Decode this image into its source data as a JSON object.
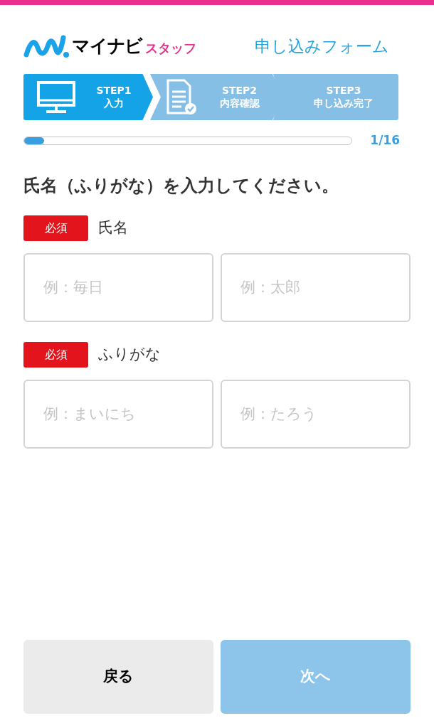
{
  "header": {
    "logo_main": "マイナビ",
    "logo_sub": "スタッフ",
    "title": "申し込みフォーム"
  },
  "steps": [
    {
      "label": "STEP1",
      "name": "入力",
      "selected": true
    },
    {
      "label": "STEP2",
      "name": "内容確認",
      "selected": false
    },
    {
      "label": "STEP3",
      "name": "申し込み完了",
      "selected": false
    }
  ],
  "progress": {
    "level": 0.06,
    "reading": "1/16"
  },
  "question": "氏名（ふりがな）を入力してください。",
  "fields": [
    {
      "badge": "必須",
      "label": "氏名",
      "inputs": [
        {
          "placeholder": "例：毎日"
        },
        {
          "placeholder": "例：太郎"
        }
      ]
    },
    {
      "badge": "必須",
      "label": "ふりがな",
      "inputs": [
        {
          "placeholder": "例：まいにち"
        },
        {
          "placeholder": "例：たろう"
        }
      ]
    }
  ],
  "buttons": [
    {
      "label": "戻る",
      "disabled": false
    },
    {
      "label": "次へ",
      "disabled": true
    }
  ]
}
